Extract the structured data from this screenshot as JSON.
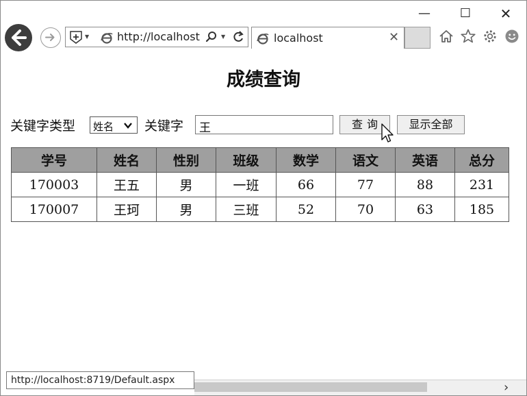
{
  "browser": {
    "window_controls": {
      "minimize": "—",
      "maximize": "☐",
      "close": "✕"
    },
    "address": {
      "url": "http://localhost"
    },
    "tab": {
      "title": "localhost"
    },
    "status_url": "http://localhost:8719/Default.aspx"
  },
  "page": {
    "title": "成绩查询",
    "keyword_type_label": "关键字类型",
    "keyword_type_value": "姓名",
    "keyword_label": "关键字",
    "keyword_value": "王",
    "query_button": "查询",
    "show_all_button": "显示全部"
  },
  "table": {
    "headers": [
      "学号",
      "姓名",
      "性别",
      "班级",
      "数学",
      "语文",
      "英语",
      "总分"
    ],
    "rows": [
      [
        "170003",
        "王五",
        "男",
        "一班",
        "66",
        "77",
        "88",
        "231"
      ],
      [
        "170007",
        "王珂",
        "男",
        "三班",
        "52",
        "70",
        "63",
        "185"
      ]
    ]
  }
}
